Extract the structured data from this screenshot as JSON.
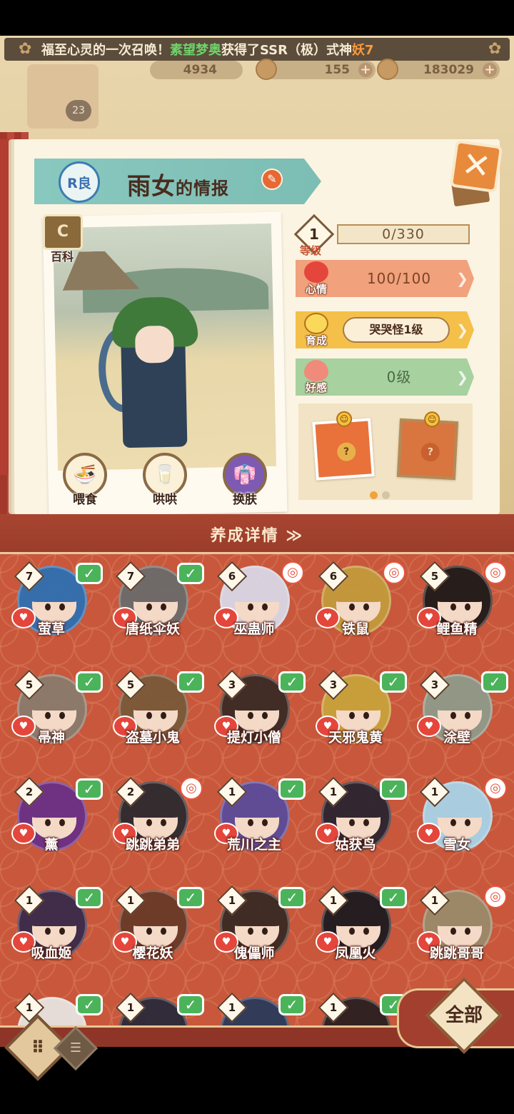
{
  "announcement": {
    "prefix": "福至心灵的一次召唤！",
    "player": "素望梦奥",
    "middle": "获得了SSR（极）式神",
    "shikigami": "妖7"
  },
  "resources": {
    "jade": "4934",
    "tickets": "155",
    "coins": "183029"
  },
  "player_level": "23",
  "header": {
    "rarity_badge": "R良",
    "name": "雨女",
    "suffix": "的情报",
    "encyclopedia_label": "百科"
  },
  "stats": {
    "level": "1",
    "level_label": "等级",
    "exp": "0/330",
    "mood_label": "心情",
    "mood": "100/100",
    "raise_label": "育成",
    "raise_stage": "哭哭怪1级",
    "affection_label": "好感",
    "affection": "0级"
  },
  "actions": {
    "feed": "喂食",
    "coax": "哄哄",
    "skin": "换肤"
  },
  "panel": {
    "title": "养成详情 ≫"
  },
  "grid": [
    {
      "lvl": "7",
      "name": "萤草",
      "badge": "check",
      "hair": "#2f6fb2"
    },
    {
      "lvl": "7",
      "name": "唐纸伞妖",
      "badge": "check",
      "hair": "#6b6b6b"
    },
    {
      "lvl": "6",
      "name": "巫蛊师",
      "badge": "mark",
      "hair": "#d9d7e6"
    },
    {
      "lvl": "6",
      "name": "铁鼠",
      "badge": "mark",
      "hair": "#c39a3c"
    },
    {
      "lvl": "5",
      "name": "鲤鱼精",
      "badge": "mark",
      "hair": "#1f1a1a"
    },
    {
      "lvl": "5",
      "name": "帚神",
      "badge": "check",
      "hair": "#8a7b6c"
    },
    {
      "lvl": "5",
      "name": "盗墓小鬼",
      "badge": "check",
      "hair": "#7a5a3a"
    },
    {
      "lvl": "3",
      "name": "提灯小僧",
      "badge": "check",
      "hair": "#3b2a25"
    },
    {
      "lvl": "3",
      "name": "天邪鬼黄",
      "badge": "check",
      "hair": "#c8a23c"
    },
    {
      "lvl": "3",
      "name": "涂壁",
      "badge": "check",
      "hair": "#8f9a8a"
    },
    {
      "lvl": "2",
      "name": "薰",
      "badge": "check",
      "hair": "#6b2f86"
    },
    {
      "lvl": "2",
      "name": "跳跳弟弟",
      "badge": "mark",
      "hair": "#2e2a30"
    },
    {
      "lvl": "1",
      "name": "荒川之主",
      "badge": "check",
      "hair": "#5b4b9a"
    },
    {
      "lvl": "1",
      "name": "姑获鸟",
      "badge": "check",
      "hair": "#2a2530"
    },
    {
      "lvl": "1",
      "name": "雪女",
      "badge": "mark",
      "hair": "#a8d3e8"
    },
    {
      "lvl": "1",
      "name": "吸血姬",
      "badge": "check",
      "hair": "#3a2a4a"
    },
    {
      "lvl": "1",
      "name": "樱花妖",
      "badge": "check",
      "hair": "#6a3a28"
    },
    {
      "lvl": "1",
      "name": "傀儡师",
      "badge": "check",
      "hair": "#3a2a24"
    },
    {
      "lvl": "1",
      "name": "凤凰火",
      "badge": "check",
      "hair": "#1e1a20"
    },
    {
      "lvl": "1",
      "name": "跳跳哥哥",
      "badge": "mark",
      "hair": "#9a8a6a"
    },
    {
      "lvl": "1",
      "name": "",
      "badge": "check",
      "hair": "#e8e4e0"
    },
    {
      "lvl": "1",
      "name": "",
      "badge": "check",
      "hair": "#2a2a3a"
    },
    {
      "lvl": "1",
      "name": "",
      "badge": "check",
      "hair": "#2a3a5a"
    },
    {
      "lvl": "1",
      "name": "",
      "badge": "check",
      "hair": "#2a2020"
    }
  ],
  "filter": {
    "label": "全部"
  },
  "colors": {
    "panel": "#c8573b",
    "check": "#4bb35a",
    "mood_band": "#f1a17c",
    "raise_band": "#f4c04a",
    "affection_band": "#a7d19f"
  }
}
